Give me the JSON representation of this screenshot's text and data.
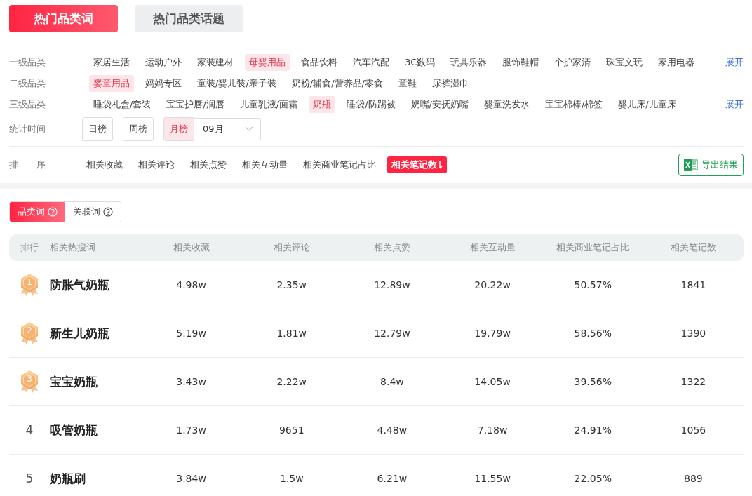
{
  "tabs": [
    {
      "label": "热门品类词",
      "selected": true
    },
    {
      "label": "热门品类话题",
      "selected": false
    }
  ],
  "filters": [
    {
      "kind": "chips",
      "label": "一级品类",
      "expand": "展开",
      "items": [
        {
          "label": "家居生活",
          "selected": false
        },
        {
          "label": "运动户外",
          "selected": false
        },
        {
          "label": "家装建材",
          "selected": false
        },
        {
          "label": "母婴用品",
          "selected": true
        },
        {
          "label": "食品饮料",
          "selected": false
        },
        {
          "label": "汽车汽配",
          "selected": false
        },
        {
          "label": "3C数码",
          "selected": false
        },
        {
          "label": "玩具乐器",
          "selected": false
        },
        {
          "label": "服饰鞋帽",
          "selected": false
        },
        {
          "label": "个护家清",
          "selected": false
        },
        {
          "label": "珠宝文玩",
          "selected": false
        },
        {
          "label": "家用电器",
          "selected": false
        }
      ]
    },
    {
      "kind": "chips",
      "label": "二级品类",
      "items": [
        {
          "label": "婴童用品",
          "selected": true
        },
        {
          "label": "妈妈专区",
          "selected": false
        },
        {
          "label": "童装/婴儿装/亲子装",
          "selected": false
        },
        {
          "label": "奶粉/辅食/营养品/零食",
          "selected": false
        },
        {
          "label": "童鞋",
          "selected": false
        },
        {
          "label": "尿裤湿巾",
          "selected": false
        }
      ]
    },
    {
      "kind": "chips",
      "label": "三级品类",
      "expand": "展开",
      "items": [
        {
          "label": "睡袋礼盒/套装",
          "selected": false
        },
        {
          "label": "宝宝护唇/润唇",
          "selected": false
        },
        {
          "label": "儿童乳液/面霜",
          "selected": false
        },
        {
          "label": "奶瓶",
          "selected": true
        },
        {
          "label": "睡袋/防踢被",
          "selected": false
        },
        {
          "label": "奶嘴/安抚奶嘴",
          "selected": false
        },
        {
          "label": "婴童洗发水",
          "selected": false
        },
        {
          "label": "宝宝棉棒/棉签",
          "selected": false
        },
        {
          "label": "婴儿床/儿童床",
          "selected": false
        }
      ]
    },
    {
      "kind": "period",
      "label": "统计时间",
      "month": "09月",
      "items": [
        {
          "label": "日榜",
          "selected": false
        },
        {
          "label": "周榜",
          "selected": false
        },
        {
          "label": "月榜",
          "selected": true
        }
      ]
    },
    {
      "kind": "sort",
      "label": "排　　序",
      "export": "导出结果",
      "items": [
        {
          "label": "相关收藏",
          "selected": false
        },
        {
          "label": "相关评论",
          "selected": false
        },
        {
          "label": "相关点赞",
          "selected": false
        },
        {
          "label": "相关互动量",
          "selected": false
        },
        {
          "label": "相关商业笔记占比",
          "selected": false
        },
        {
          "label": "相关笔记数",
          "selected": true
        }
      ]
    }
  ],
  "word_types": [
    {
      "label": "品类词",
      "selected": true
    },
    {
      "label": "关联词",
      "selected": false
    }
  ],
  "table": {
    "columns": [
      "排行",
      "相关热搜词",
      "相关收藏",
      "相关评论",
      "相关点赞",
      "相关互动量",
      "相关商业笔记占比",
      "相关笔记数"
    ],
    "rows": [
      {
        "kind": "medal",
        "rank": "1",
        "keyword": "防胀气奶瓶",
        "values": [
          "4.98w",
          "2.35w",
          "12.89w",
          "20.22w",
          "50.57%",
          "1841"
        ]
      },
      {
        "kind": "medal",
        "rank": "2",
        "keyword": "新生儿奶瓶",
        "values": [
          "5.19w",
          "1.81w",
          "12.79w",
          "19.79w",
          "58.56%",
          "1390"
        ]
      },
      {
        "kind": "medal",
        "rank": "3",
        "keyword": "宝宝奶瓶",
        "values": [
          "3.43w",
          "2.22w",
          "8.4w",
          "14.05w",
          "39.56%",
          "1322"
        ]
      },
      {
        "kind": "plain",
        "rank": "4",
        "keyword": "吸管奶瓶",
        "values": [
          "1.73w",
          "9651",
          "4.48w",
          "7.18w",
          "24.91%",
          "1056"
        ]
      },
      {
        "kind": "plain",
        "rank": "5",
        "keyword": "奶瓶刷",
        "values": [
          "3.84w",
          "1.5w",
          "6.21w",
          "11.55w",
          "22.05%",
          "889"
        ]
      }
    ]
  }
}
